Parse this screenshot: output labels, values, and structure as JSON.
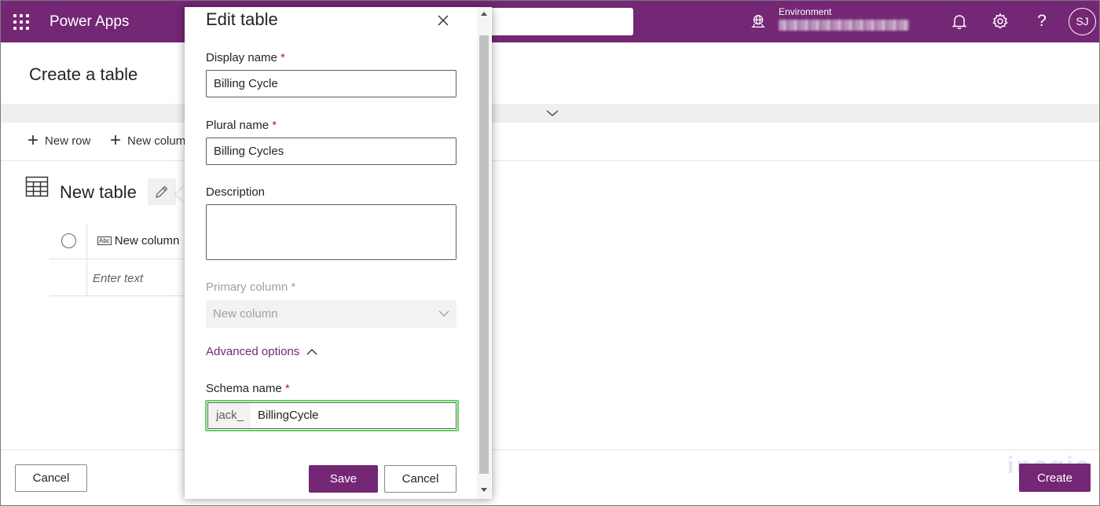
{
  "topbar": {
    "app_name": "Power Apps",
    "environment_label": "Environment",
    "avatar_initials": "SJ",
    "brand_color": "#742774"
  },
  "page": {
    "title": "Create a table",
    "commands": {
      "new_row": "New row",
      "new_column": "New column"
    },
    "table_name": "New table",
    "grid": {
      "column_header": "New column",
      "cell_placeholder": "Enter text"
    },
    "cancel_label": "Cancel",
    "create_label": "Create"
  },
  "dialog": {
    "title": "Edit table",
    "display_name": {
      "label": "Display name",
      "required": "*",
      "value": "Billing Cycle"
    },
    "plural_name": {
      "label": "Plural name",
      "required": "*",
      "value": "Billing Cycles"
    },
    "description": {
      "label": "Description",
      "value": ""
    },
    "primary_column": {
      "label": "Primary column",
      "required": "*",
      "value": "New column"
    },
    "advanced_options": "Advanced options",
    "schema_name": {
      "label": "Schema name",
      "required": "*",
      "prefix": "jack_",
      "value": "BillingCycle"
    },
    "save_label": "Save",
    "cancel_label": "Cancel",
    "highlight_color": "#5bd65b"
  }
}
